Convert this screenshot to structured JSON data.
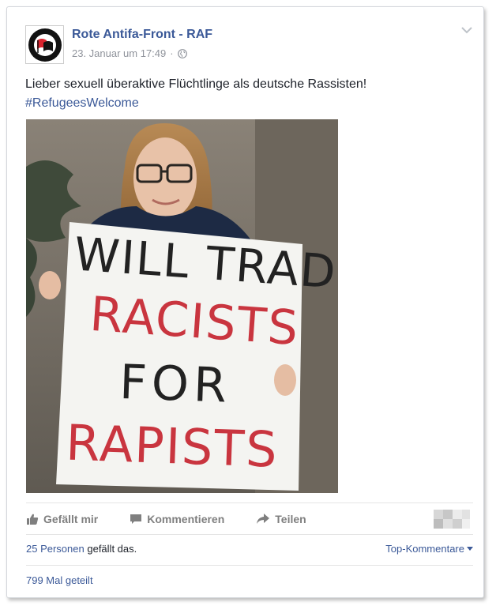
{
  "post": {
    "page_name": "Rote Antifa-Front - RAF",
    "timestamp": "23. Januar um 17:49",
    "separator": "·",
    "text": "Lieber sexuell überaktive Flüchtlinge als deutsche Rassisten!",
    "hashtag": "#RefugeesWelcome",
    "avatar_icon": "antifa-logo-icon",
    "privacy_icon": "globe-icon"
  },
  "photo": {
    "sign_lines": [
      "WILL TRADE",
      "RACISTS",
      "FOR",
      "RAPISTS"
    ],
    "sign_colors": [
      "#222222",
      "#c9353f",
      "#222222",
      "#c9353f"
    ]
  },
  "actions": {
    "like_label": "Gefällt mir",
    "comment_label": "Kommentieren",
    "share_label": "Teilen"
  },
  "stats": {
    "likes_count_link": "25 Personen",
    "likes_suffix": "gefällt das.",
    "top_comments_label": "Top-Kommentare",
    "shares_label": "799 Mal geteilt"
  },
  "colors": {
    "link": "#3b5998",
    "muted": "#90949c",
    "action_text": "#7f7f7f"
  }
}
